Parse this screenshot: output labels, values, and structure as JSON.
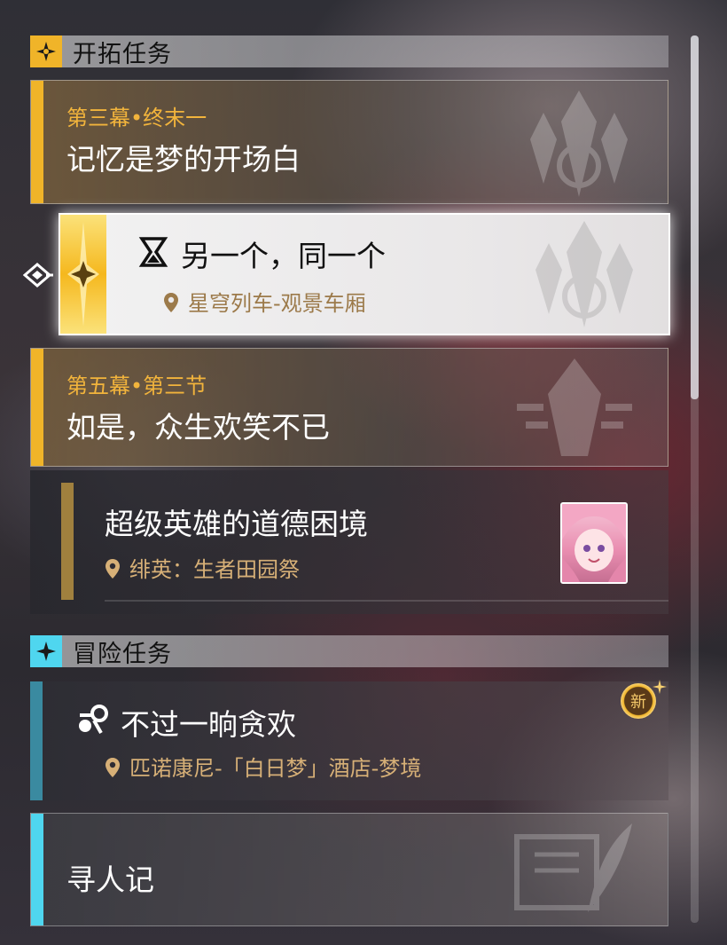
{
  "sections": {
    "trailblaze": {
      "title": "开拓任务"
    },
    "adventure": {
      "title": "冒险任务"
    }
  },
  "trailblaze_missions": [
    {
      "chapter": "第三幕•终末一",
      "name": "记忆是梦的开场白"
    },
    {
      "name": "另一个，同一个",
      "location": "星穹列车-观景车厢"
    },
    {
      "chapter": "第五幕•第三节",
      "name": "如是，众生欢笑不已"
    },
    {
      "name": "超级英雄的道德困境",
      "location": "绯英：生者田园祭"
    }
  ],
  "adventure_missions": [
    {
      "name": "不过一晌贪欢",
      "location": "匹诺康尼-「白日梦」酒店-梦境",
      "badge": "新"
    },
    {
      "name": "寻人记"
    }
  ],
  "colors": {
    "trailblaze_accent": "#f0b429",
    "adventure_accent": "#4fd6ef",
    "location_text": "#d7b077"
  }
}
